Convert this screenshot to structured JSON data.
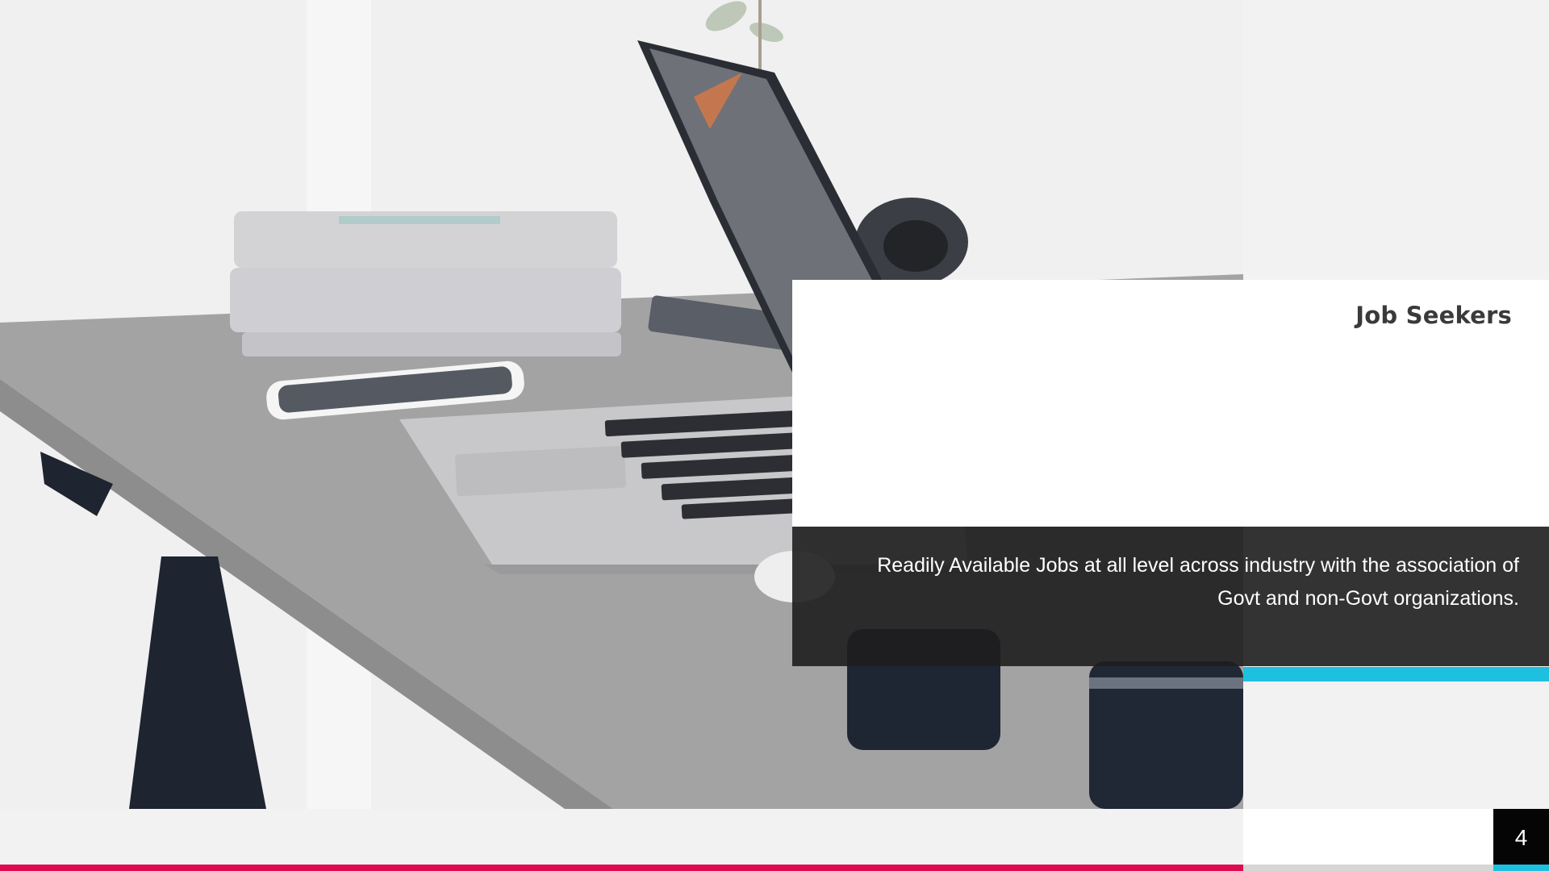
{
  "slide": {
    "title": "Job Seekers",
    "description": "Readily Available Jobs at all level across industry with the association of Govt and non-Govt organizations.",
    "page_number": "4"
  },
  "colors": {
    "accent_pink": "#e0084e",
    "accent_cyan": "#1ec0e0",
    "dark_panel": "#1e1e1e",
    "background": "#f2f2f2"
  },
  "image": {
    "subject": "desk-with-laptop-photo"
  }
}
